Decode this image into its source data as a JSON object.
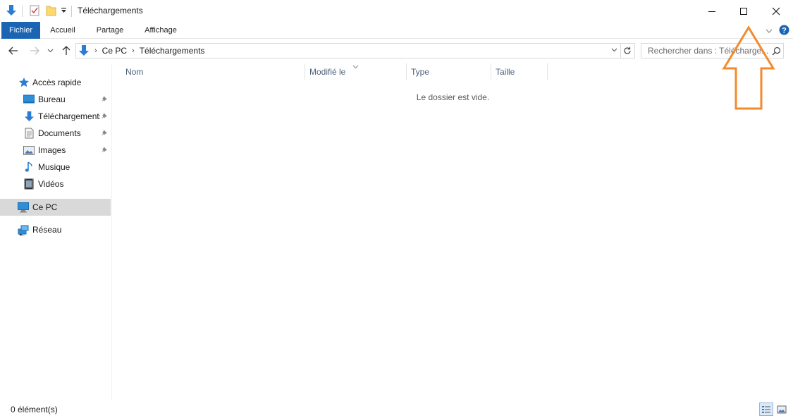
{
  "window": {
    "title": "Téléchargements"
  },
  "ribbon": {
    "tabs": [
      "Fichier",
      "Accueil",
      "Partage",
      "Affichage"
    ]
  },
  "address": {
    "crumbs": [
      "Ce PC",
      "Téléchargements"
    ]
  },
  "search": {
    "placeholder": "Rechercher dans : Télécharge..."
  },
  "sidebar": {
    "quick_access": "Accès rapide",
    "items": [
      {
        "label": "Bureau",
        "icon": "desktop-icon",
        "pinned": true
      },
      {
        "label": "Téléchargements",
        "icon": "downloads-icon",
        "pinned": true
      },
      {
        "label": "Documents",
        "icon": "documents-icon",
        "pinned": true
      },
      {
        "label": "Images",
        "icon": "images-icon",
        "pinned": true
      },
      {
        "label": "Musique",
        "icon": "music-icon",
        "pinned": false
      },
      {
        "label": "Vidéos",
        "icon": "videos-icon",
        "pinned": false
      }
    ],
    "this_pc": "Ce PC",
    "network": "Réseau"
  },
  "columns": [
    "Nom",
    "Modifié le",
    "Type",
    "Taille"
  ],
  "content": {
    "empty_message": "Le dossier est vide."
  },
  "status": {
    "item_count": "0 élément(s)"
  },
  "colors": {
    "accent": "#1a64b4",
    "annotation": "#f58a2c",
    "selection": "#d9d9d9"
  }
}
